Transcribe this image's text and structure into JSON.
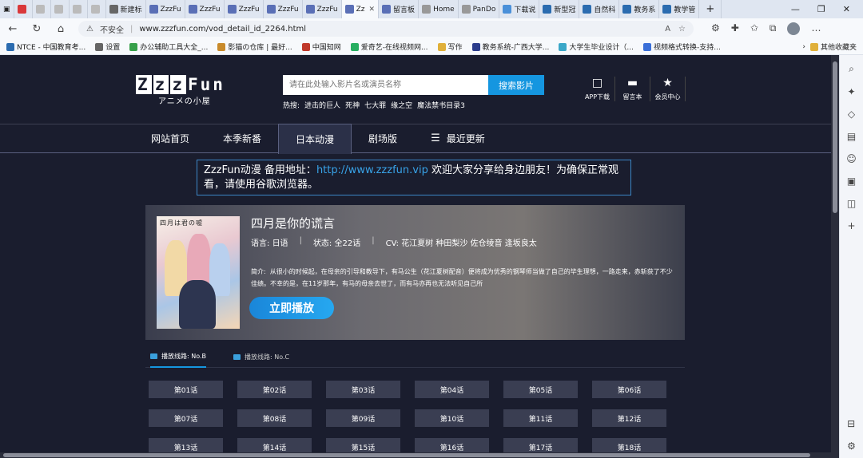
{
  "browser": {
    "tabs": [
      {
        "label": "",
        "color": "#d9383a"
      },
      {
        "label": "",
        "color": "#bbb"
      },
      {
        "label": "",
        "color": "#bbb"
      },
      {
        "label": "",
        "color": "#bbb"
      },
      {
        "label": "",
        "color": "#bbb"
      },
      {
        "label": "新建标",
        "color": "#666"
      },
      {
        "label": "ZzzFu",
        "color": "#5a6fb6"
      },
      {
        "label": "ZzzFu",
        "color": "#5a6fb6"
      },
      {
        "label": "ZzzFu",
        "color": "#5a6fb6"
      },
      {
        "label": "ZzzFu",
        "color": "#5a6fb6"
      },
      {
        "label": "ZzzFu",
        "color": "#5a6fb6"
      },
      {
        "label": "Zz",
        "color": "#5a6fb6",
        "active": true
      },
      {
        "label": "留言板",
        "color": "#5a6fb6"
      },
      {
        "label": "Home",
        "color": "#999"
      },
      {
        "label": "PanDo",
        "color": "#999"
      },
      {
        "label": "下载说",
        "color": "#4a90d9"
      },
      {
        "label": "新型冠",
        "color": "#2b6cb0"
      },
      {
        "label": "自然科",
        "color": "#2b6cb0"
      },
      {
        "label": "教务系",
        "color": "#2b6cb0"
      },
      {
        "label": "教学管",
        "color": "#2b6cb0"
      }
    ],
    "new_tab": "+",
    "url_warning": "不安全",
    "url": "www.zzzfun.com/vod_detail_id_2264.html",
    "bookmarks": [
      {
        "label": "NTCE - 中国教育考...",
        "color": "#2b6cb0"
      },
      {
        "label": "设置",
        "color": "#666"
      },
      {
        "label": "办公辅助工具大全_...",
        "color": "#37a04a"
      },
      {
        "label": "影猫の仓库 | 最好...",
        "color": "#c88a2b"
      },
      {
        "label": "中国知网",
        "color": "#c0392b"
      },
      {
        "label": "爱奇艺-在线视频网...",
        "color": "#27ae60"
      },
      {
        "label": "写作",
        "color": "#e0b03a"
      },
      {
        "label": "教务系统-广西大学...",
        "color": "#2b3c8c"
      },
      {
        "label": "大学生毕业设计（...",
        "color": "#3aa7c8"
      },
      {
        "label": "视频格式转换-支持...",
        "color": "#3a6fd8"
      }
    ],
    "bookmarks_more": "其他收藏夹"
  },
  "site": {
    "logo_main": "ZzzFun",
    "logo_sub": "アニメの小屋",
    "search_placeholder": "请在此处输入影片名或演员名称",
    "search_button": "搜索影片",
    "hot_label": "热搜:",
    "hot_items": [
      "进击的巨人",
      "死神",
      "七大罪",
      "缘之空",
      "魔法禁书目录3"
    ],
    "tools": [
      {
        "icon": "□",
        "label": "APP下载"
      },
      {
        "icon": "▬",
        "label": "留言本"
      },
      {
        "icon": "★",
        "label": "会员中心"
      }
    ],
    "nav": [
      {
        "label": "网站首页"
      },
      {
        "label": "本季新番"
      },
      {
        "label": "日本动漫",
        "active": true
      },
      {
        "label": "剧场版"
      },
      {
        "label": "最近更新",
        "menu": true
      }
    ],
    "notice_prefix": "ZzzFun动漫 备用地址：",
    "notice_link": "http://www.zzzfun.vip",
    "notice_suffix": " 欢迎大家分享给身边朋友！为确保正常观看，请使用谷歌浏览器。"
  },
  "detail": {
    "poster_title": "四月は君の嘘",
    "title": "四月是你的谎言",
    "language_label": "语言:",
    "language": "日语",
    "status_label": "状态:",
    "status": "全22话",
    "cv_label": "CV:",
    "cv": "花江夏树 种田梨沙 佐仓绫音 逢坂良太",
    "desc_label": "简介:",
    "desc": "从很小的时候起，在母亲的引导和教导下，有马公生（花江夏树配音）便将成为优秀的钢琴师当做了自己的毕生理想，一路走来，赤斩获了不少佳绩。不幸的是，在11岁那年，有马的母亲去世了，而有马亦再也无法听见自己所",
    "play_button": "立即播放"
  },
  "lines": [
    {
      "label": "播放线路: No.B",
      "active": true
    },
    {
      "label": "播放线路: No.C"
    }
  ],
  "episodes": [
    "第01话",
    "第02话",
    "第03话",
    "第04话",
    "第05话",
    "第06话",
    "第07话",
    "第08话",
    "第09话",
    "第10话",
    "第11话",
    "第12话",
    "第13话",
    "第14话",
    "第15话",
    "第16话",
    "第17话",
    "第18话"
  ]
}
